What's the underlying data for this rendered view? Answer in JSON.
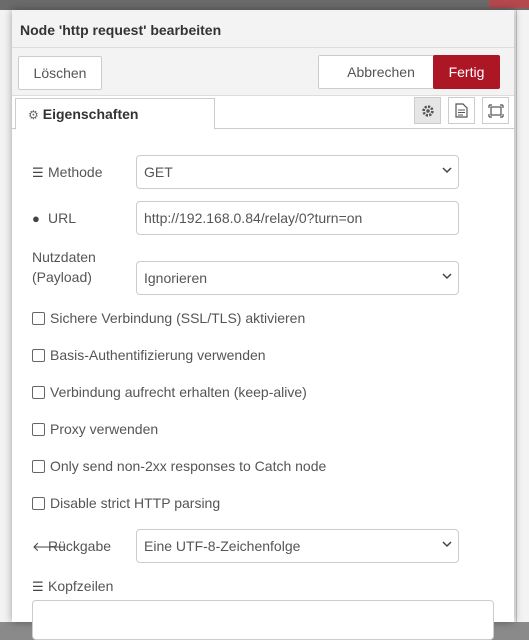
{
  "dialog": {
    "title": "Node 'http request' bearbeiten",
    "buttons": {
      "delete": "Löschen",
      "cancel": "Abbrechen",
      "done": "Fertig"
    },
    "tab": {
      "label": "Eigenschaften",
      "icon": "gear-icon"
    },
    "tab_icons": [
      "gear-icon",
      "document-icon",
      "frame-icon"
    ]
  },
  "form": {
    "method": {
      "label": "Methode",
      "icon": "tasks-icon",
      "value": "GET"
    },
    "url": {
      "label": "URL",
      "icon": "globe-icon",
      "value": "http://192.168.0.84/relay/0?turn=on"
    },
    "payload": {
      "label_line1": "Nutzdaten",
      "label_line2": "(Payload)",
      "value": "Ignorieren"
    },
    "checkboxes": [
      {
        "label": "Sichere Verbindung (SSL/TLS) aktivieren",
        "checked": false
      },
      {
        "label": "Basis-Authentifizierung verwenden",
        "checked": false
      },
      {
        "label": "Verbindung aufrecht erhalten (keep-alive)",
        "checked": false
      },
      {
        "label": "Proxy verwenden",
        "checked": false
      },
      {
        "label": "Only send non-2xx responses to Catch node",
        "checked": false
      },
      {
        "label": "Disable strict HTTP parsing",
        "checked": false
      }
    ],
    "return": {
      "label": "Rückgabe",
      "icon": "arrow-left-icon",
      "value": "Eine UTF-8-Zeichenfolge"
    },
    "headers": {
      "label": "Kopfzeilen",
      "icon": "list-icon"
    }
  },
  "colors": {
    "primary": "#ad1625",
    "border": "#cccccc",
    "header_bg": "#f3f3f3"
  }
}
